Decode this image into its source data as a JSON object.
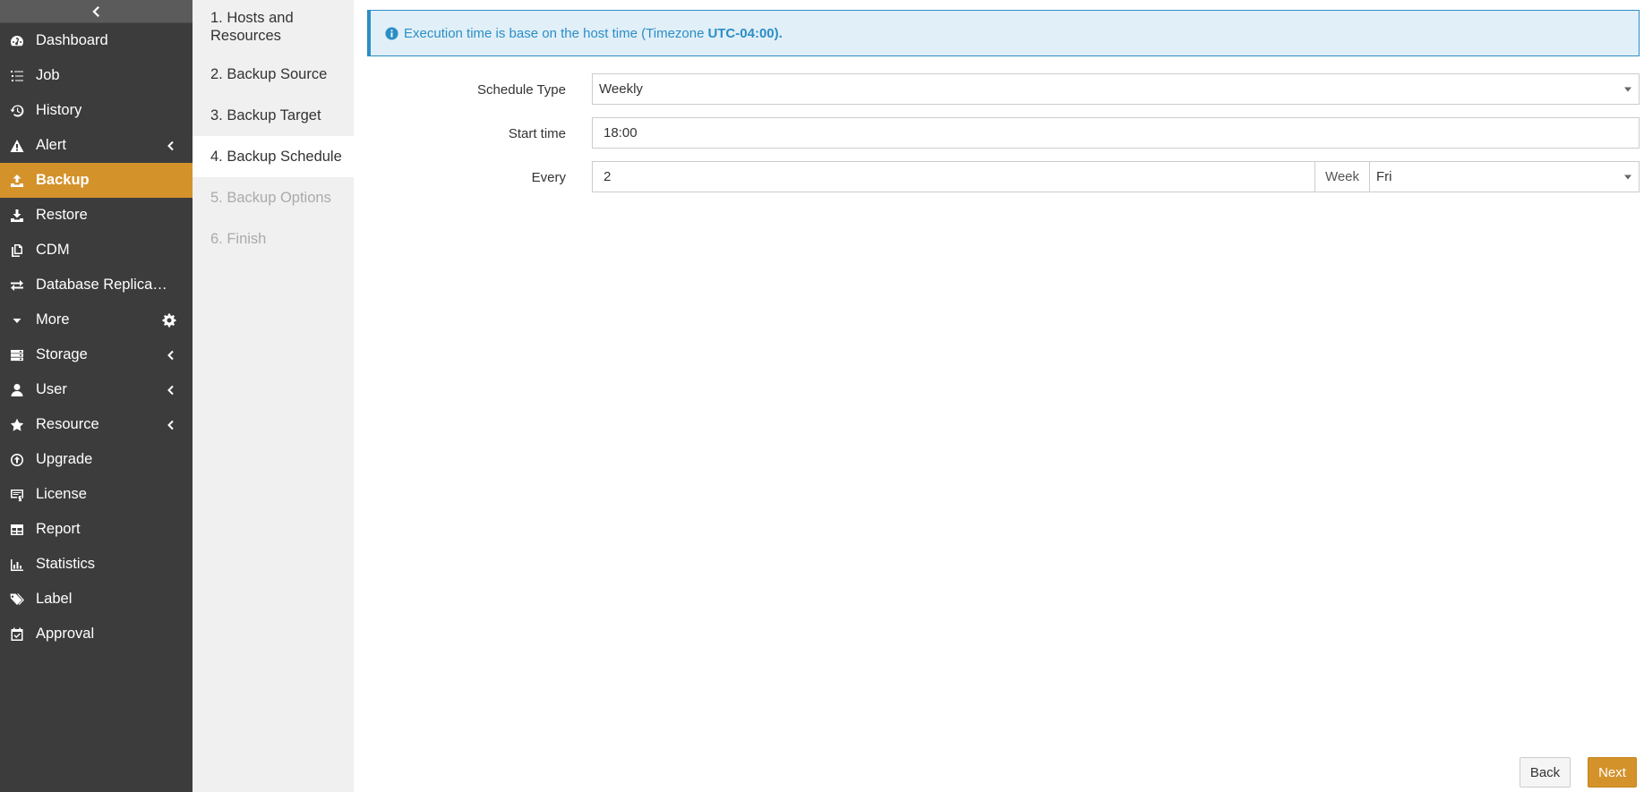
{
  "sidebar": {
    "items": [
      {
        "label": "Dashboard",
        "icon": "dashboard-icon"
      },
      {
        "label": "Job",
        "icon": "list-icon"
      },
      {
        "label": "History",
        "icon": "history-icon"
      },
      {
        "label": "Alert",
        "icon": "warning-icon"
      },
      {
        "label": "Backup",
        "icon": "upload-icon"
      },
      {
        "label": "Restore",
        "icon": "download-icon"
      },
      {
        "label": "CDM",
        "icon": "copy-icon"
      },
      {
        "label": "Database Replica…",
        "icon": "exchange-icon"
      },
      {
        "label": "More",
        "icon": "caret-down-icon"
      },
      {
        "label": "Storage",
        "icon": "storage-icon"
      },
      {
        "label": "User",
        "icon": "user-icon"
      },
      {
        "label": "Resource",
        "icon": "star-icon"
      },
      {
        "label": "Upgrade",
        "icon": "upgrade-icon"
      },
      {
        "label": "License",
        "icon": "license-icon"
      },
      {
        "label": "Report",
        "icon": "table-icon"
      },
      {
        "label": "Statistics",
        "icon": "bar-chart-icon"
      },
      {
        "label": "Label",
        "icon": "tags-icon"
      },
      {
        "label": "Approval",
        "icon": "calendar-check-icon"
      }
    ],
    "active": "Backup",
    "accent_color": "#d4922b"
  },
  "steps": [
    {
      "label": "1. Hosts and Resources",
      "state": "done"
    },
    {
      "label": "2. Backup Source",
      "state": "done"
    },
    {
      "label": "3. Backup Target",
      "state": "done"
    },
    {
      "label": "4. Backup Schedule",
      "state": "current"
    },
    {
      "label": "5. Backup Options",
      "state": "disabled"
    },
    {
      "label": "6. Finish",
      "state": "disabled"
    }
  ],
  "alert": {
    "text": "Execution time is base on the host time (Timezone",
    "timezone": "UTC-04:00)."
  },
  "form": {
    "schedule_type_label": "Schedule Type",
    "schedule_type_value": "Weekly",
    "start_time_label": "Start time",
    "start_time_value": "18:00",
    "every_label": "Every",
    "every_value": "2",
    "every_unit": "Week",
    "day_value": "Fri"
  },
  "buttons": {
    "back": "Back",
    "next": "Next"
  }
}
